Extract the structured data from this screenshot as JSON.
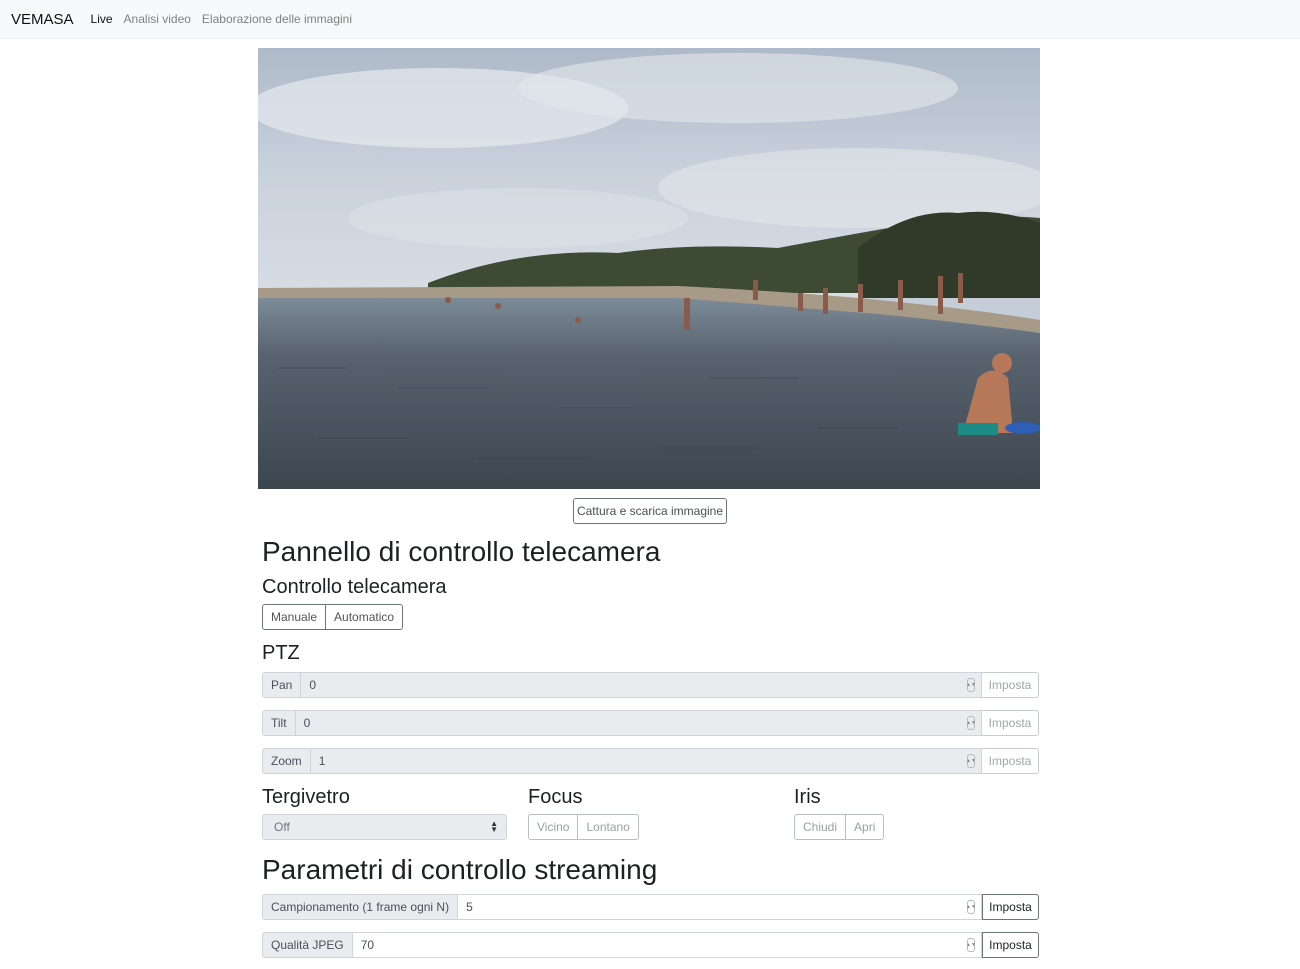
{
  "navbar": {
    "brand": "VEMASA",
    "links": [
      {
        "label": "Live",
        "active": true
      },
      {
        "label": "Analisi video",
        "active": false
      },
      {
        "label": "Elaborazione delle immagini",
        "active": false
      }
    ]
  },
  "live": {
    "capture_button": "Cattura e scarica immagine"
  },
  "camera_panel": {
    "title": "Pannello di controllo telecamera",
    "control": {
      "title": "Controllo telecamera",
      "modes": [
        "Manuale",
        "Automatico"
      ]
    },
    "ptz": {
      "title": "PTZ",
      "rows": [
        {
          "label": "Pan",
          "value": "0",
          "button": "Imposta"
        },
        {
          "label": "Tilt",
          "value": "0",
          "button": "Imposta"
        },
        {
          "label": "Zoom",
          "value": "1",
          "button": "Imposta"
        }
      ]
    },
    "wiper": {
      "title": "Tergivetro",
      "selected": "Off"
    },
    "focus": {
      "title": "Focus",
      "buttons": [
        "Vicino",
        "Lontano"
      ]
    },
    "iris": {
      "title": "Iris",
      "buttons": [
        "Chiudi",
        "Apri"
      ]
    }
  },
  "streaming": {
    "title": "Parametri di controllo streaming",
    "rows": [
      {
        "label": "Campionamento (1 frame ogni N)",
        "value": "5",
        "button": "Imposta"
      },
      {
        "label": "Qualità JPEG",
        "value": "70",
        "button": "Imposta"
      }
    ]
  },
  "colors": {
    "navbar_bg": "#f8f9fa",
    "addon_bg": "#e9ecef",
    "border": "#6c757d",
    "sky": "#c5cdd8",
    "sea": "#4a5563"
  }
}
